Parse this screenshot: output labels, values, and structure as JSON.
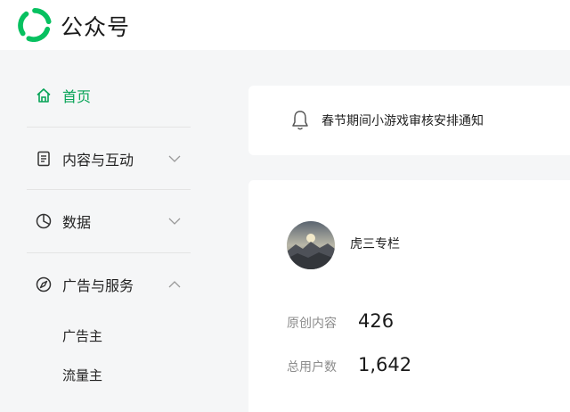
{
  "header": {
    "brand": "公众号",
    "logo_icon": "wechat-official-account-logo",
    "brand_color": "#07c160"
  },
  "sidebar": {
    "items": [
      {
        "label": "首页",
        "icon": "home-icon",
        "active": true
      },
      {
        "label": "内容与互动",
        "icon": "document-icon",
        "expanded": false
      },
      {
        "label": "数据",
        "icon": "pie-chart-icon",
        "expanded": false
      },
      {
        "label": "广告与服务",
        "icon": "compass-icon",
        "expanded": true
      }
    ],
    "sub_items": [
      {
        "label": "广告主"
      },
      {
        "label": "流量主"
      }
    ],
    "active_color": "#07a357"
  },
  "notice": {
    "icon": "bell-icon",
    "text": "春节期间小游戏审核安排通知"
  },
  "account": {
    "name": "虎三专栏",
    "stats": [
      {
        "label": "原创内容",
        "value": "426"
      },
      {
        "label": "总用户数",
        "value": "1,642"
      }
    ]
  }
}
